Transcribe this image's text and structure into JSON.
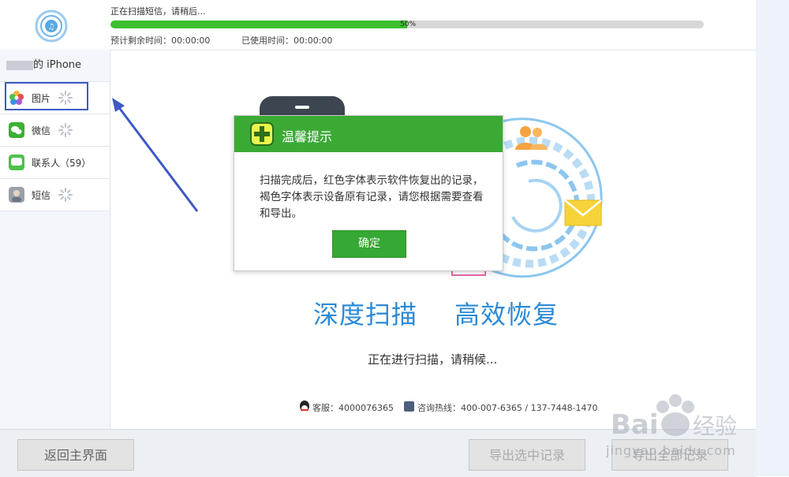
{
  "header": {
    "scan_status": "正在扫描短信，请稍后...",
    "progress_percent": 50,
    "progress_text": "50%",
    "time_remaining": "预计剩余时间：00:00:00",
    "time_used": "已使用时间：00:00:00"
  },
  "sidebar": {
    "device_name": "的 iPhone",
    "items": [
      {
        "label": "图片",
        "icon": "photos-icon",
        "loading": true
      },
      {
        "label": "微信",
        "icon": "wechat-icon",
        "loading": true
      },
      {
        "label": "联系人（59）",
        "icon": "contacts-icon",
        "loading": false
      },
      {
        "label": "短信",
        "icon": "sms-icon",
        "loading": true
      }
    ]
  },
  "main": {
    "slogan_1": "深度扫描",
    "slogan_2": "高效恢复",
    "scanning_text": "正在进行扫描，请稍候...",
    "service_label": "客服：4000076365",
    "hotline_label": "咨询热线：400-007-6365 / 137-7448-1470"
  },
  "dialog": {
    "title": "温馨提示",
    "message": "扫描完成后，红色字体表示软件恢复出的记录，褐色字体表示设备原有记录，请您根据需要查看和导出。",
    "confirm_label": "确定"
  },
  "footer": {
    "back_label": "返回主界面",
    "export_selected_label": "导出选中记录",
    "export_all_label": "导出全部记录"
  },
  "watermark": {
    "text": "jingyan.baidu.com"
  },
  "colors": {
    "accent_green": "#3aaa35",
    "slogan_blue": "#2a8ad6",
    "highlight_border": "#3f58c6"
  }
}
